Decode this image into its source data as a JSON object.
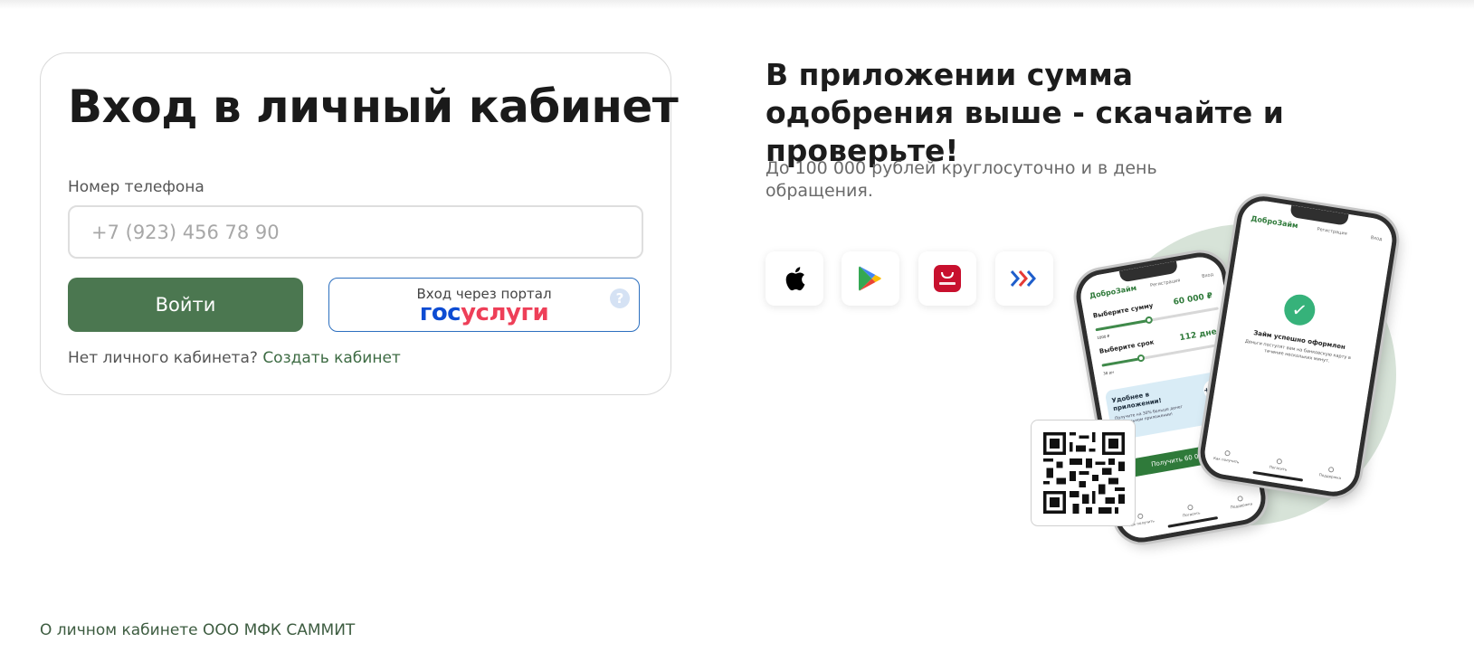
{
  "login": {
    "title": "Вход в личный кабинет",
    "phone_label": "Номер телефона",
    "phone_placeholder": "+7 (923) 456 78 90",
    "phone_value": "",
    "submit_label": "Войти",
    "gosuslugi_caption": "Вход через портал",
    "gosuslugi_logo_gos": "гос",
    "gosuslugi_logo_uslugi": "услуги",
    "help_glyph": "?",
    "no_account_text": "Нет личного кабинета?",
    "create_link": "Создать кабинет"
  },
  "promo": {
    "title": "В приложении сумма одобрения выше - скачайте и проверьте!",
    "subtitle": "До 100 000 рублей круглосуточно и в день обращения.",
    "stores": [
      {
        "icon": "apple-icon",
        "color": "#000000"
      },
      {
        "icon": "google-play-icon",
        "color": "#34a853"
      },
      {
        "icon": "huawei-appgallery-icon",
        "color": "#c8102e"
      },
      {
        "icon": "rustore-icon",
        "color": "#1f5ecb"
      }
    ]
  },
  "app_screens": {
    "back": {
      "logo": "ДоброЗайм",
      "link_register": "Регистрация",
      "link_login": "Вход",
      "amount_label": "Выберите сумму",
      "amount_value": "60 000 ₽",
      "amount_min": "1000 ₽",
      "term_label": "Выберите срок",
      "term_value": "112 дней",
      "term_min": "30 дн",
      "banner_title": "Удобнее в приложении!",
      "banner_note": "Получите на 30% больше денег в мобильном приложении!",
      "banner_badge": "+30%",
      "cta": "Получить 60 000 ₽",
      "tabs": [
        "Как получить",
        "Погасить",
        "Поддержка"
      ]
    },
    "front": {
      "logo": "ДоброЗайм",
      "link_register": "Регистрация",
      "link_login": "Вход",
      "success_title": "Займ успешно оформлен",
      "success_note": "Деньги поступят вам на банковскую карту в течение нескольких минут.",
      "tabs": [
        "Как получить",
        "Погасить",
        "Поддержка"
      ]
    }
  },
  "colors": {
    "accent": "#4b7750",
    "link": "#3d6b43",
    "gos_blue": "#0d4cd3",
    "gos_red": "#ee3f58",
    "circle_bg": "#d7e3d8"
  },
  "footer": {
    "link": "О личном кабинете ООО МФК САММИТ"
  }
}
